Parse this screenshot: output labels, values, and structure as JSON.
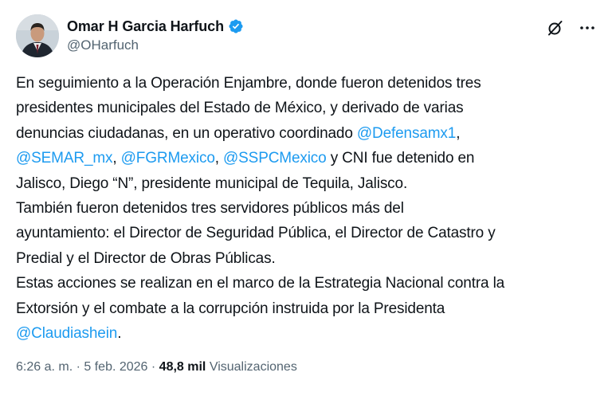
{
  "author": {
    "display_name": "Omar H Garcia Harfuch",
    "handle": "@OHarfuch",
    "verified_icon": "verified-badge-icon",
    "avatar_icon": "avatar"
  },
  "actions": {
    "grok_icon": "grok-icon",
    "more_icon": "more-options-icon"
  },
  "body": {
    "l1": "En seguimiento a la Operación Enjambre, donde fueron detenidos tres",
    "l2": "presidentes municipales del Estado de México, y derivado de varias",
    "l3_text": "denuncias ciudadanas, en un operativo coordinado ",
    "l3_mention": "@Defensamx1",
    "l3_tail": ",",
    "l4_m1": "@SEMAR_mx",
    "l4_sep1": ", ",
    "l4_m2": "@FGRMexico",
    "l4_sep2": ", ",
    "l4_m3": "@SSPCMexico",
    "l4_text": " y CNI fue detenido en",
    "l5": "Jalisco, Diego “N”, presidente municipal de Tequila, Jalisco.",
    "l6": "También fueron detenidos tres servidores públicos más del",
    "l7": "ayuntamiento: el Director de Seguridad Pública, el Director de Catastro y",
    "l8": "Predial y el Director de Obras Públicas.",
    "l9": "Estas acciones se realizan en el marco de la Estrategia Nacional contra la",
    "l10": "Extorsión y el combate a la corrupción instruida por la Presidenta",
    "l11_mention": "@Claudiashein",
    "l11_tail": "."
  },
  "meta": {
    "time": "6:26 a. m.",
    "sep1": " · ",
    "date": "5 feb. 2026",
    "sep2": " · ",
    "views_count": "48,8 mil",
    "views_label": " Visualizaciones"
  },
  "colors": {
    "text": "#0f1419",
    "secondary": "#536471",
    "link": "#1d9bf0",
    "background": "#ffffff"
  }
}
